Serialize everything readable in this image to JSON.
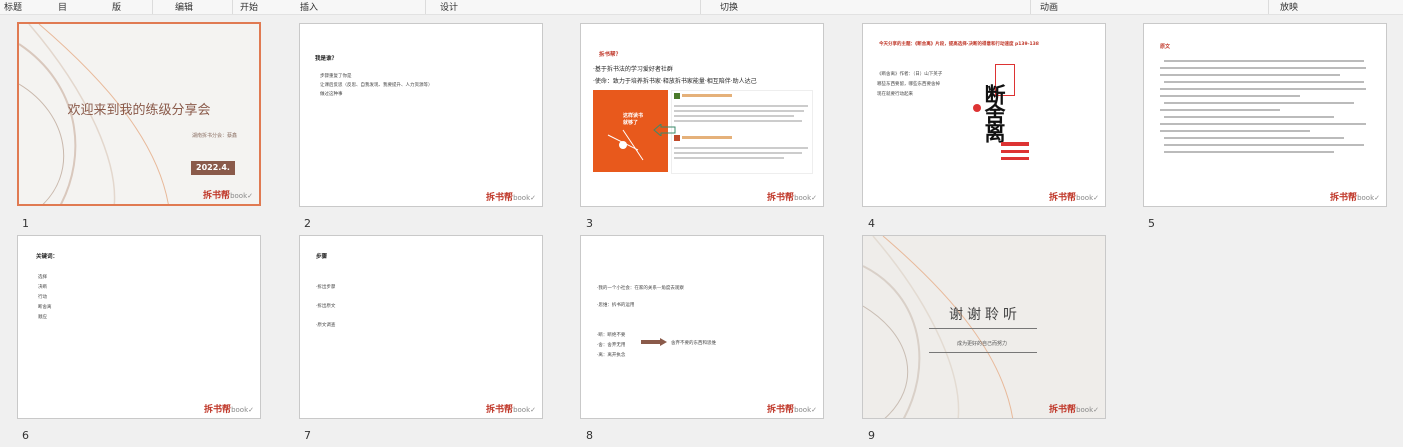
{
  "ribbon": {
    "items": [
      "标题",
      "目",
      "版",
      "编辑",
      "开始",
      "插入",
      "设计",
      "切换",
      "动画",
      "放映"
    ]
  },
  "slides": [
    {
      "number": "1",
      "title": "欢迎来到我的练级分享会",
      "subtitle": "湖南拆书分会：蔡鑫",
      "date": "2022.4.",
      "brand": "拆书帮"
    },
    {
      "number": "2",
      "heading": "我是谁？",
      "bullets": [
        "步骤重复了你是",
        "让课后反思（反思、自我发现、我要提升、人力资源等）",
        "做过这种事"
      ],
      "brand": "拆书帮"
    },
    {
      "number": "3",
      "header": "拆书帮？",
      "bullets": [
        "·基于拆书法的学习爱好者社群",
        "·使命：致力于培养拆书家·释放拆书家能量·相互陪伴·助人达己"
      ],
      "book_title": "这样读书就够了",
      "brand": "拆书帮"
    },
    {
      "number": "4",
      "header": "今天分享的主题：《断舍离》片段，提高选择·决断的得意和行动速度 p139-138",
      "bullets": [
        "《断舍离》作者：（日）山下英子",
        "哪些东西要留，哪些东西要舍掉",
        "现在就要行动起来"
      ],
      "book_title": "断舍离",
      "brand": "拆书帮"
    },
    {
      "number": "5",
      "header": "原文",
      "brand": "拆书帮"
    },
    {
      "number": "6",
      "heading": "关键词：",
      "bullets": [
        "选择",
        "决断",
        "行动",
        "断舍离",
        "顺应"
      ],
      "brand": "拆书帮"
    },
    {
      "number": "7",
      "heading": "步骤",
      "bullets": [
        "·拆出步骤",
        "·拆出原文",
        "·原文调查"
      ],
      "brand": "拆书帮"
    },
    {
      "number": "8",
      "bullets": [
        "·我的一个小社会：在家的关系—角度去观察",
        "·思维：拆书的运用"
      ],
      "bullets2": [
        "·断：断绝不要",
        "·舍：舍弃无用",
        "·离：离开执念"
      ],
      "arrow_text": "舍弃不要的东西和思维",
      "brand": "拆书帮"
    },
    {
      "number": "9",
      "title": "谢谢聆听",
      "subtitle": "成为更好的自己而努力",
      "brand": "拆书帮"
    }
  ],
  "colors": {
    "accent": "#e07a52",
    "brand_red": "#c0392b",
    "date_bg": "#8a5a4a"
  }
}
